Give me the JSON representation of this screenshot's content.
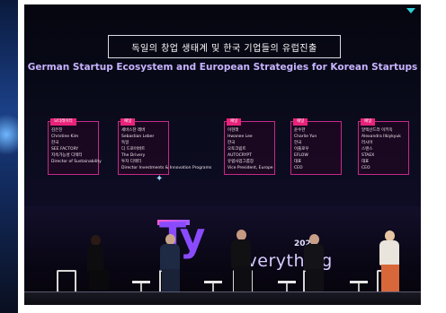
{
  "screen": {
    "title_ko": "독일의 창업 생태계 및 한국 기업들의 유럽진출",
    "title_en": "German Startup Ecosystem and European Strategies for Korean Startups"
  },
  "cards": [
    {
      "tag": "모더레이터",
      "lines": [
        "김은진",
        "Christine Kim",
        "한국",
        "SEE FACTORY",
        "지속가능성 디렉터",
        "Director of Sustainability"
      ]
    },
    {
      "tag": "패널",
      "lines": [
        "세바스찬 레버",
        "Sebastian Leber",
        "독일",
        "디 드로어버트",
        "The Drivery",
        "투자 디렉터",
        "Director Investments & Innovation Programs"
      ]
    },
    {
      "tag": "패널",
      "lines": [
        "이현래",
        "Hwanee Lee",
        "한국",
        "오토크립트",
        "AUTOCRYPT",
        "유럽사업그룹장",
        "Vice President, Europe"
      ]
    },
    {
      "tag": "패널",
      "lines": [
        "윤수한",
        "Charlie Yun",
        "한국",
        "이플로우",
        "EFLOW",
        "대표",
        "CEO"
      ]
    },
    {
      "tag": "패널",
      "lines": [
        "알렉산드라 이키옥",
        "Alexandra Ilkiykyuk",
        "러시아",
        "스탠스",
        "STAEX",
        "대표",
        "CEO"
      ]
    }
  ],
  "event_logo": {
    "mark": "Ty",
    "year": "2024",
    "sub": "Everything"
  },
  "colors": {
    "screen_bg": "#05060f",
    "card_border": "#c6298a",
    "tag_bg": "#e8237a",
    "title_en": "#c7b3ff",
    "logo_purple": "#8a4bff"
  }
}
